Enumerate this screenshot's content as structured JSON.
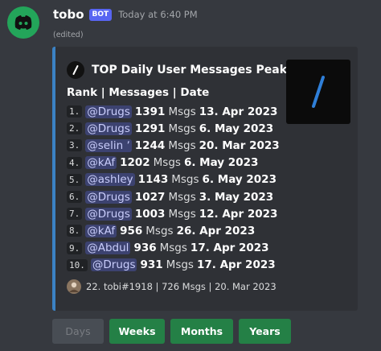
{
  "message": {
    "author": "tobo",
    "bot_tag": "BOT",
    "timestamp": "Today at 6:40 PM",
    "edited": "(edited)"
  },
  "embed": {
    "author_name": "TOP Daily User Messages Peaks",
    "title": "Rank | Messages | Date",
    "accent_color": "#3b82c4",
    "rows": [
      {
        "rank": "1.",
        "user": "@Drugs",
        "count": "1391",
        "unit": "Msgs",
        "date": "13. Apr 2023"
      },
      {
        "rank": "2.",
        "user": "@Drugs",
        "count": "1291",
        "unit": "Msgs",
        "date": "6. May 2023"
      },
      {
        "rank": "3.",
        "user": "@selin ʼ",
        "count": "1244",
        "unit": "Msgs",
        "date": "20. Mar 2023"
      },
      {
        "rank": "4.",
        "user": "@kAf",
        "count": "1202",
        "unit": "Msgs",
        "date": "6. May 2023"
      },
      {
        "rank": "5.",
        "user": "@ashley",
        "count": "1143",
        "unit": "Msgs",
        "date": "6. May 2023"
      },
      {
        "rank": "6.",
        "user": "@Drugs",
        "count": "1027",
        "unit": "Msgs",
        "date": "3. May 2023"
      },
      {
        "rank": "7.",
        "user": "@Drugs",
        "count": "1003",
        "unit": "Msgs",
        "date": "12. Apr 2023"
      },
      {
        "rank": "8.",
        "user": "@kAf",
        "count": "956",
        "unit": "Msgs",
        "date": "26. Apr 2023"
      },
      {
        "rank": "9.",
        "user": "@Abdul",
        "count": "936",
        "unit": "Msgs",
        "date": "17. Apr 2023"
      },
      {
        "rank": "10.",
        "user": "@Drugs",
        "count": "931",
        "unit": "Msgs",
        "date": "17. Apr 2023"
      }
    ],
    "footer": "22. tobi#1918 | 726 Msgs | 20. Mar 2023"
  },
  "buttons": {
    "days": "Days",
    "weeks": "Weeks",
    "months": "Months",
    "years": "Years"
  },
  "icons": {
    "avatar": "discord-logo-icon",
    "embed_author": "slash-logo-icon",
    "thumbnail": "slash-logo-icon",
    "footer": "user-avatar-icon"
  }
}
